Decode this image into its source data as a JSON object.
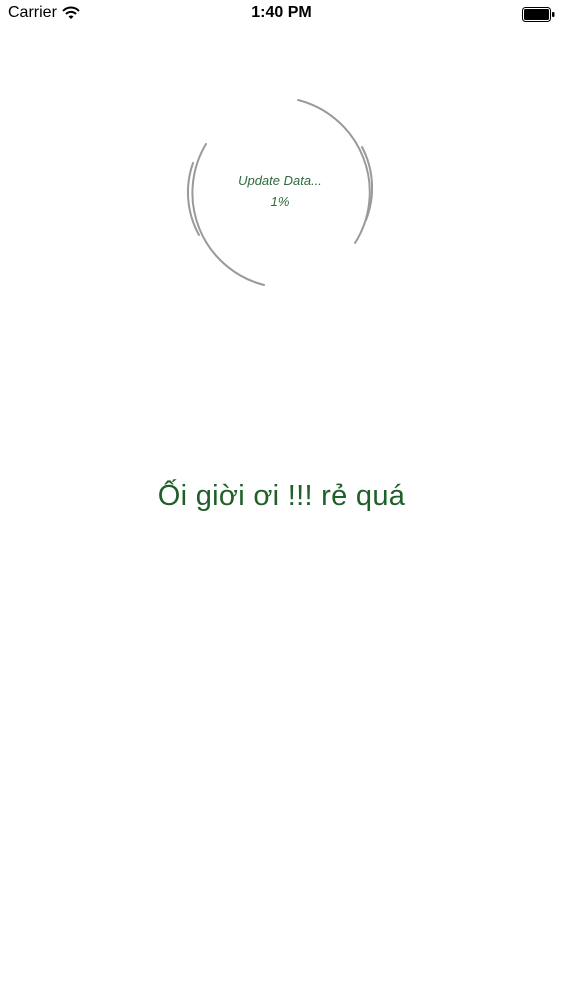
{
  "status_bar": {
    "carrier": "Carrier",
    "time": "1:40 PM",
    "icons": [
      "wifi-icon",
      "battery-icon"
    ]
  },
  "loader": {
    "title": "Update Data...",
    "percent_text": "1%",
    "progress": 0.01,
    "color": "#2e6b3c",
    "ring_color": "#9a9a9a"
  },
  "tagline": {
    "text": "Ối giời ơi !!! rẻ quá",
    "color": "#1f5f2a"
  }
}
